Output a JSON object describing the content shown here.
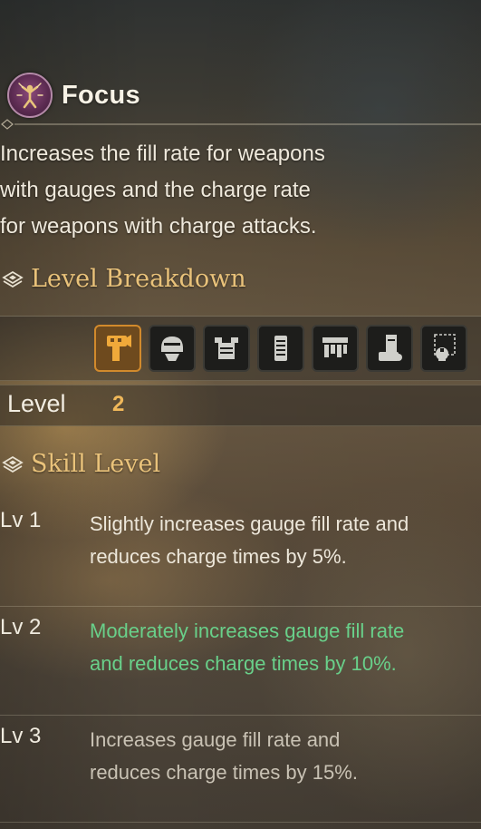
{
  "skill": {
    "name": "Focus",
    "icon": "focus-skill-icon",
    "description_lines": [
      "Increases the fill rate for weapons",
      "with gauges and the charge rate",
      "for weapons with charge attacks."
    ]
  },
  "level_breakdown": {
    "heading": "Level Breakdown",
    "equipment_slots": [
      {
        "icon": "weapon-icon",
        "active": true
      },
      {
        "icon": "helm-icon",
        "active": false
      },
      {
        "icon": "chest-armor-icon",
        "active": false
      },
      {
        "icon": "arm-armor-icon",
        "active": false
      },
      {
        "icon": "waist-armor-icon",
        "active": false
      },
      {
        "icon": "leg-armor-icon",
        "active": false
      },
      {
        "icon": "talisman-icon",
        "active": false
      }
    ],
    "level_label": "Level",
    "level_value": "2"
  },
  "skill_level": {
    "heading": "Skill Level",
    "levels": [
      {
        "label": "Lv 1",
        "line1": "Slightly increases gauge fill rate and",
        "line2": "reduces charge times by 5%.",
        "state": "achieved"
      },
      {
        "label": "Lv 2",
        "line1": "Moderately increases gauge fill rate",
        "line2": "and reduces charge times by 10%.",
        "state": "current"
      },
      {
        "label": "Lv 3",
        "line1": "Increases gauge fill rate and",
        "line2": "reduces charge times by 15%.",
        "state": "locked"
      }
    ]
  },
  "colors": {
    "heading_gold": "#e9c27a",
    "current_level_green": "#69d08a",
    "level_value_orange": "#f0b85a",
    "active_slot": "#d28a2c"
  }
}
